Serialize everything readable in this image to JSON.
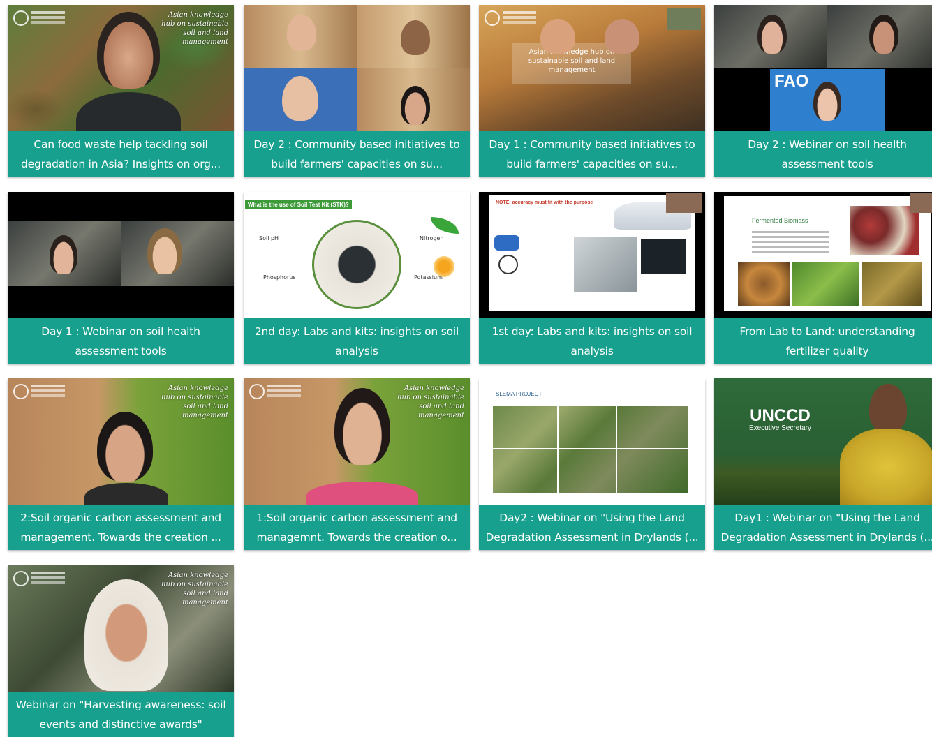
{
  "hub_logo_text": "Asian knowledge hub on sustainable soil and land management",
  "cards": [
    {
      "caption": "Can food waste help tackling soil degradation in Asia? Insights on org..."
    },
    {
      "caption": "Day 2 : Community based initiatives to build farmers' capacities on su..."
    },
    {
      "caption": "Day 1 : Community based initiatives to build farmers' capacities on su..."
    },
    {
      "caption": "Day 2 : Webinar on soil health assessment tools"
    },
    {
      "caption": "Day 1 : Webinar on soil health assessment tools"
    },
    {
      "caption": "2nd day: Labs and kits: insights on soil analysis"
    },
    {
      "caption": "1st day: Labs and kits: insights on soil analysis"
    },
    {
      "caption": "From Lab to Land: understanding fertilizer quality"
    },
    {
      "caption": "2:Soil organic carbon assessment and management. Towards the creation ..."
    },
    {
      "caption": "1:Soil organic carbon assessment and managemnt. Towards the creation o..."
    },
    {
      "caption": "Day2 : Webinar on \"Using the Land Degradation Assessment in Drylands (..."
    },
    {
      "caption": "Day1 : Webinar on \"Using the Land Degradation Assessment in Drylands (..."
    },
    {
      "caption": "Webinar on \"Harvesting awareness: soil events and distinctive awards\""
    }
  ],
  "thumb_text": {
    "fao": "FAO",
    "stk_title": "What is the use of Soil Test Kit (STK)?",
    "stk_labels": [
      "Soil pH",
      "Nitrogen",
      "Phosphorus",
      "Potassium"
    ],
    "labs_title": "NOTE: accuracy must fit with the purpose",
    "fert_title": "Fermented Biomass",
    "slm_title": "SLEMA PROJECT",
    "unccd": "UNCCD",
    "unccd_sub": "Executive Secretary"
  }
}
